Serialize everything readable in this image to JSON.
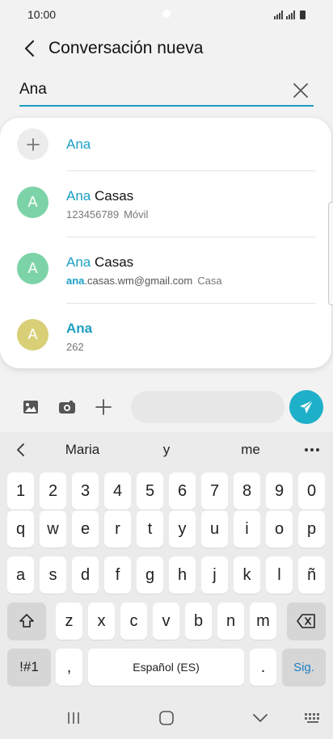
{
  "status": {
    "time": "10:00"
  },
  "header": {
    "title": "Conversación nueva",
    "back_icon": "chevron-left-icon"
  },
  "recipient": {
    "value": "Ana",
    "clear_icon": "close-icon"
  },
  "suggestions": {
    "add": {
      "label": "Ana"
    },
    "items": [
      {
        "avatar": "A",
        "name_match": "Ana",
        "name_rest": " Casas",
        "detail_match": "",
        "detail_rest": "123456789",
        "detail_type": "Móvil",
        "color": "#7dd3a8"
      },
      {
        "avatar": "A",
        "name_match": "Ana",
        "name_rest": " Casas",
        "detail_match": "ana",
        "detail_rest": ".casas.wm@gmail.com",
        "detail_type": "Casa",
        "color": "#7dd3a8"
      },
      {
        "avatar": "A",
        "name_match": "Ana",
        "name_rest": "",
        "detail_match": "",
        "detail_rest": "262",
        "detail_type": "",
        "color": "#d8cf77"
      }
    ]
  },
  "compose": {
    "icons": [
      "image-icon",
      "camera-icon",
      "add-icon"
    ],
    "send_icon": "send-icon",
    "placeholder": ""
  },
  "keyboard": {
    "predictions": [
      "Maria",
      "y",
      "me"
    ],
    "row_numbers": [
      "1",
      "2",
      "3",
      "4",
      "5",
      "6",
      "7",
      "8",
      "9",
      "0"
    ],
    "row_1": [
      "q",
      "w",
      "e",
      "r",
      "t",
      "y",
      "u",
      "i",
      "o",
      "p"
    ],
    "row_2": [
      "a",
      "s",
      "d",
      "f",
      "g",
      "h",
      "j",
      "k",
      "l",
      "ñ"
    ],
    "row_3": [
      "z",
      "x",
      "c",
      "v",
      "b",
      "n",
      "m"
    ],
    "symbols_key": "!#1",
    "comma_key": ",",
    "space_key": "Español (ES)",
    "period_key": ".",
    "action_key": "Sig."
  },
  "colors": {
    "accent": "#1b9fc3",
    "send": "#1fb0c9"
  }
}
